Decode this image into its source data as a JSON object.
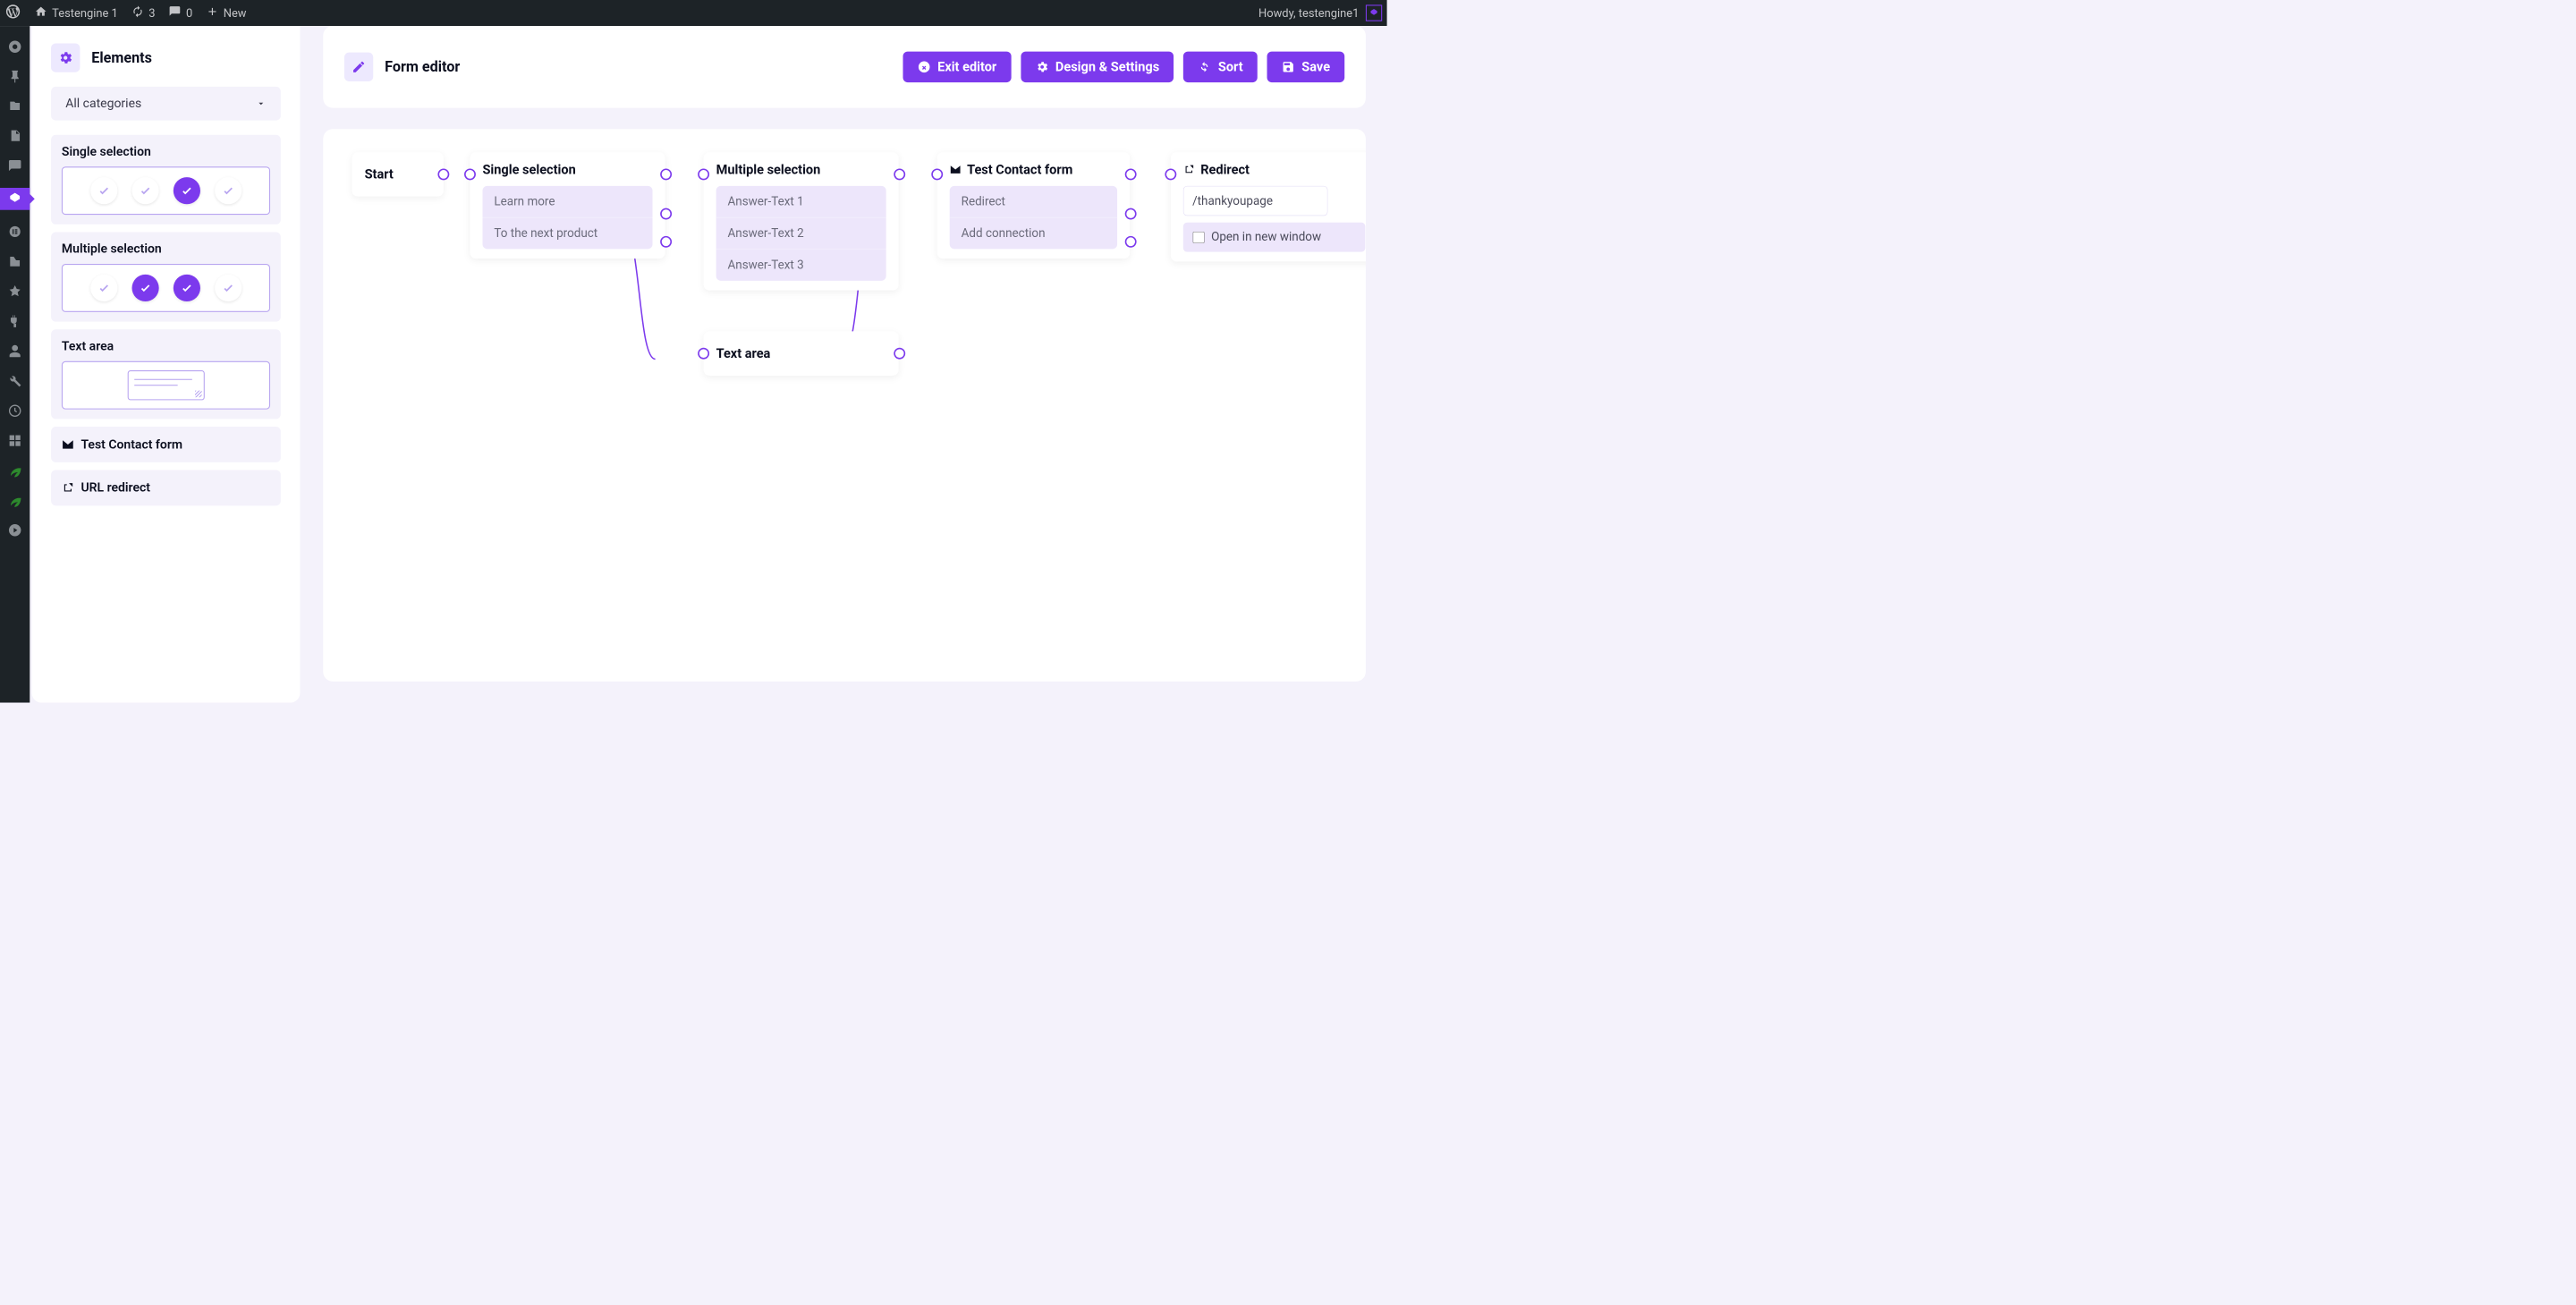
{
  "adminbar": {
    "site_name": "Testengine 1",
    "updates_count": "3",
    "comments_count": "0",
    "new_label": "New",
    "greeting": "Howdy, testengine1"
  },
  "elements_panel": {
    "title": "Elements",
    "category_select": "All categories",
    "items": {
      "single_selection": "Single selection",
      "multiple_selection": "Multiple selection",
      "text_area": "Text area",
      "contact_form": "Test Contact form",
      "url_redirect": "URL redirect"
    }
  },
  "editor": {
    "title": "Form editor",
    "buttons": {
      "exit": "Exit editor",
      "design": "Design & Settings",
      "sort": "Sort",
      "save": "Save"
    }
  },
  "canvas": {
    "start": {
      "title": "Start"
    },
    "single": {
      "title": "Single selection",
      "options": [
        "Learn more",
        "To the next product"
      ]
    },
    "multiple": {
      "title": "Multiple selection",
      "options": [
        "Answer-Text 1",
        "Answer-Text 2",
        "Answer-Text 3"
      ]
    },
    "textarea": {
      "title": "Text area"
    },
    "contact": {
      "title": "Test Contact form",
      "options": [
        "Redirect",
        "Add connection"
      ]
    },
    "redirect": {
      "title": "Redirect",
      "url": "/thankyoupage",
      "new_window_label": "Open in new window"
    }
  }
}
